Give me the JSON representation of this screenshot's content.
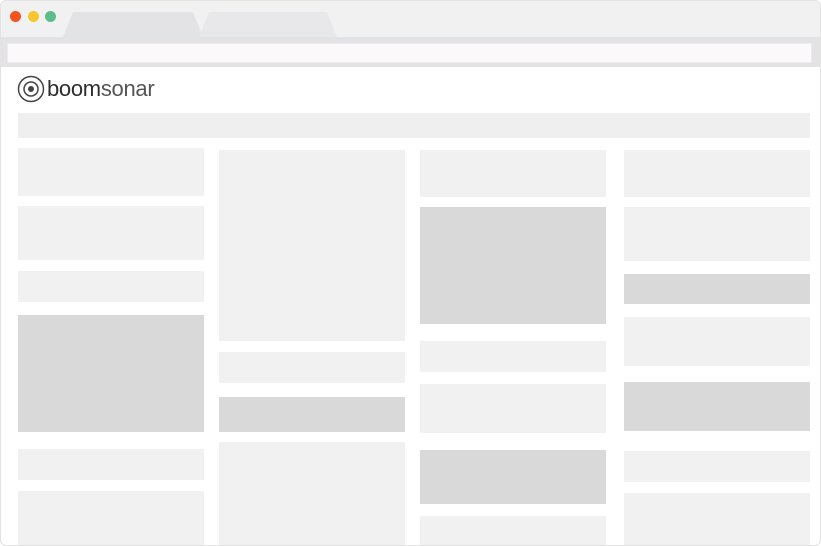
{
  "window": {
    "controls": [
      "close",
      "minimize",
      "maximize"
    ],
    "colors": {
      "close": "#f1541d",
      "minimize": "#f8c52c",
      "maximize": "#5bbd8a"
    }
  },
  "tabs": [
    {
      "label": "",
      "active": true
    },
    {
      "label": "",
      "active": false
    }
  ],
  "addressbar": {
    "value": ""
  },
  "brand": {
    "name_strong": "boom",
    "name_light": "sonar",
    "icon": "target-icon"
  },
  "placeholder_colors": {
    "light": "#f1f1f1",
    "dark": "#d9d9d9"
  }
}
